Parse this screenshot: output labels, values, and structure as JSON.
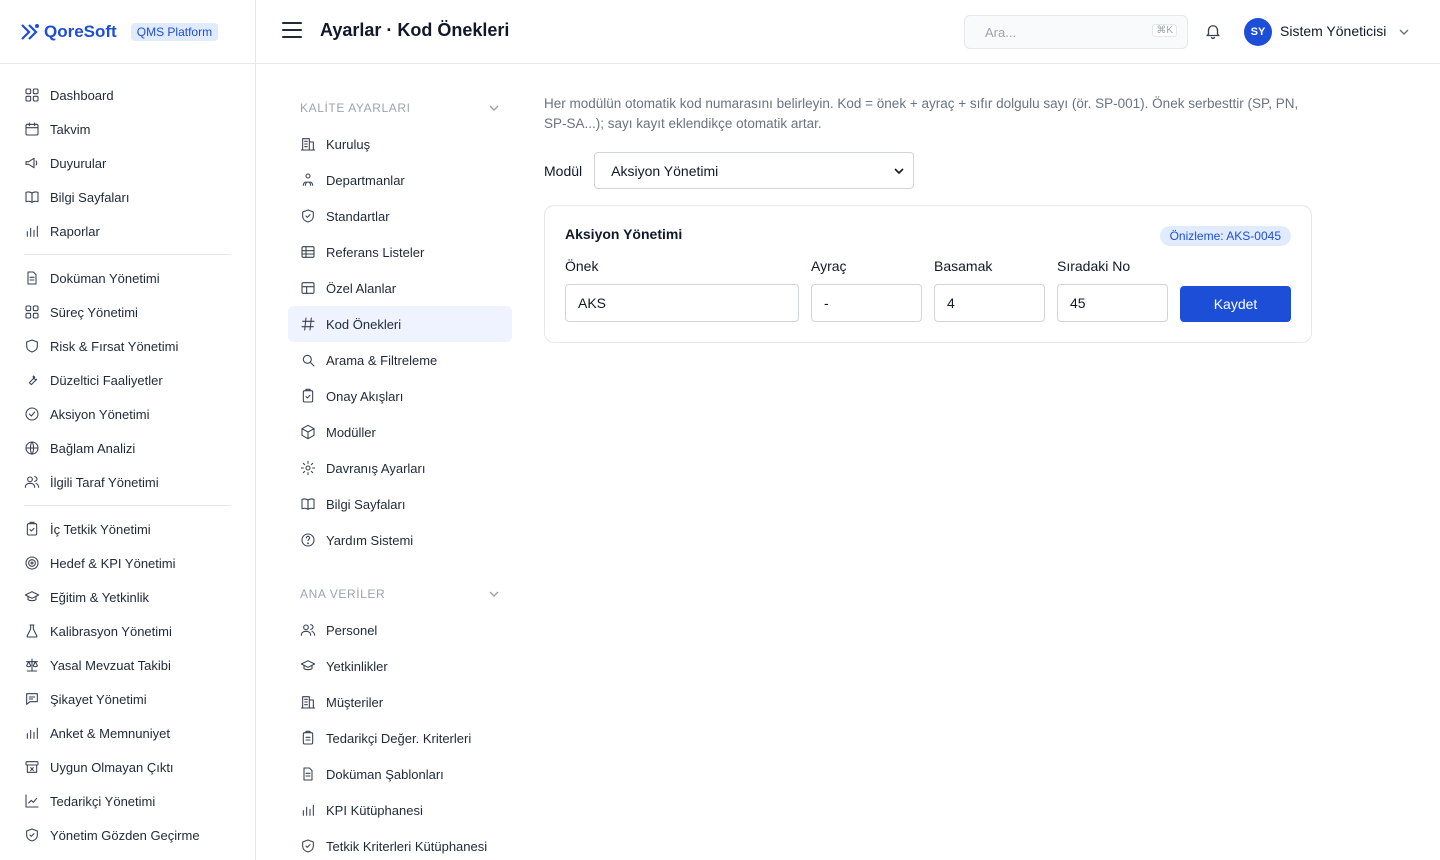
{
  "brand": {
    "name": "QoreSoft",
    "badge": "QMS Platform"
  },
  "header": {
    "title": "Ayarlar · Kod Önekleri",
    "search_placeholder": "Ara...",
    "search_shortcut": "⌘K",
    "user_initials": "SY",
    "user_name": "Sistem Yöneticisi"
  },
  "sidebar": {
    "groups": [
      [
        {
          "label": "Dashboard",
          "icon": "dashboard-icon"
        },
        {
          "label": "Takvim",
          "icon": "calendar-icon"
        },
        {
          "label": "Duyurular",
          "icon": "megaphone-icon"
        },
        {
          "label": "Bilgi Sayfaları",
          "icon": "book-icon"
        },
        {
          "label": "Raporlar",
          "icon": "bar-chart-icon"
        }
      ],
      [
        {
          "label": "Doküman Yönetimi",
          "icon": "document-icon"
        },
        {
          "label": "Süreç Yönetimi",
          "icon": "process-icon"
        },
        {
          "label": "Risk & Fırsat Yönetimi",
          "icon": "shield-icon"
        },
        {
          "label": "Düzeltici Faaliyetler",
          "icon": "wrench-icon"
        },
        {
          "label": "Aksiyon Yönetimi",
          "icon": "check-circle-icon"
        },
        {
          "label": "Bağlam Analizi",
          "icon": "globe-icon"
        },
        {
          "label": "İlgili Taraf Yönetimi",
          "icon": "users-icon"
        }
      ],
      [
        {
          "label": "İç Tetkik Yönetimi",
          "icon": "clipboard-check-icon"
        },
        {
          "label": "Hedef & KPI Yönetimi",
          "icon": "target-icon"
        },
        {
          "label": "Eğitim & Yetkinlik",
          "icon": "graduation-cap-icon"
        },
        {
          "label": "Kalibrasyon Yönetimi",
          "icon": "flask-icon"
        },
        {
          "label": "Yasal Mevzuat Takibi",
          "icon": "scale-icon"
        },
        {
          "label": "Şikayet Yönetimi",
          "icon": "message-icon"
        },
        {
          "label": "Anket & Memnuniyet",
          "icon": "bar-chart-icon"
        },
        {
          "label": "Uygun Olmayan Çıktı",
          "icon": "archive-x-icon"
        },
        {
          "label": "Tedarikçi Yönetimi",
          "icon": "line-chart-icon"
        },
        {
          "label": "Yönetim Gözden Geçirme",
          "icon": "shield-check-icon"
        }
      ]
    ]
  },
  "settings_nav": {
    "sections": [
      {
        "title": "KALİTE AYARLARI",
        "items": [
          {
            "label": "Kuruluş",
            "icon": "building-icon",
            "active": false
          },
          {
            "label": "Departmanlar",
            "icon": "org-chart-icon",
            "active": false
          },
          {
            "label": "Standartlar",
            "icon": "shield-check-icon",
            "active": false
          },
          {
            "label": "Referans Listeler",
            "icon": "table-icon",
            "active": false
          },
          {
            "label": "Özel Alanlar",
            "icon": "layout-icon",
            "active": false
          },
          {
            "label": "Kod Önekleri",
            "icon": "hash-icon",
            "active": true
          },
          {
            "label": "Arama & Filtreleme",
            "icon": "search-icon",
            "active": false
          },
          {
            "label": "Onay Akışları",
            "icon": "clipboard-check-icon",
            "active": false
          },
          {
            "label": "Modüller",
            "icon": "package-icon",
            "active": false
          },
          {
            "label": "Davranış Ayarları",
            "icon": "gear-icon",
            "active": false
          },
          {
            "label": "Bilgi Sayfaları",
            "icon": "book-icon",
            "active": false
          },
          {
            "label": "Yardım Sistemi",
            "icon": "help-circle-icon",
            "active": false
          }
        ]
      },
      {
        "title": "ANA VERİLER",
        "items": [
          {
            "label": "Personel",
            "icon": "users-icon",
            "active": false
          },
          {
            "label": "Yetkinlikler",
            "icon": "graduation-cap-icon",
            "active": false
          },
          {
            "label": "Müşteriler",
            "icon": "building-icon",
            "active": false
          },
          {
            "label": "Tedarikçi Değer. Kriterleri",
            "icon": "clipboard-icon",
            "active": false
          },
          {
            "label": "Doküman Şablonları",
            "icon": "document-icon",
            "active": false
          },
          {
            "label": "KPI Kütüphanesi",
            "icon": "bar-chart-icon",
            "active": false
          },
          {
            "label": "Tetkik Kriterleri Kütüphanesi",
            "icon": "shield-check-icon",
            "active": false
          }
        ]
      }
    ]
  },
  "main": {
    "description": "Her modülün otomatik kod numarasını belirleyin. Kod = önek + ayraç + sıfır dolgulu sayı (ör. SP-001). Önek serbesttir (SP, PN, SP-SA...); sayı kayıt eklendikçe otomatik artar.",
    "module_label": "Modül",
    "module_selected": "Aksiyon Yönetimi",
    "card": {
      "title": "Aksiyon Yönetimi",
      "preview": "Önizleme: AKS-0045",
      "prefix_label": "Önek",
      "prefix_value": "AKS",
      "separator_label": "Ayraç",
      "separator_value": "-",
      "digits_label": "Basamak",
      "digits_value": "4",
      "next_label": "Sıradaki No",
      "next_value": "45",
      "save_label": "Kaydet"
    }
  },
  "colors": {
    "accent": "#1d4ed8",
    "active_bg": "#eef3ff",
    "badge_bg": "#e0ebff"
  }
}
